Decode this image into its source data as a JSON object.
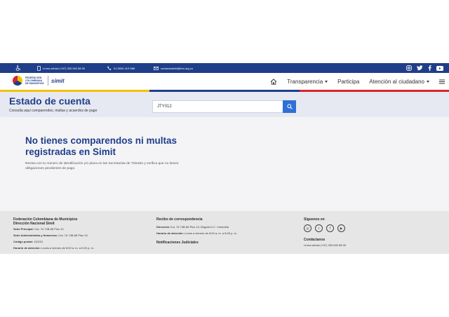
{
  "topbar": {
    "accessibility_icon": "wheelchair-icon",
    "phone_label": "Línea celular (+57) 333 602 88 00",
    "landline_label": "01 8000 413 588",
    "email_label": "contactosimit@fcm.org.co",
    "social": [
      "instagram-icon",
      "twitter-icon",
      "facebook-icon",
      "youtube-icon"
    ]
  },
  "nav": {
    "logo_org": "FEDERACIÓN COLOMBIANA DE MUNICIPIOS",
    "logo_brand": "simit",
    "links": [
      "Transparencia",
      "Participa",
      "Atención al ciudadano"
    ]
  },
  "colors": {
    "primary": "#1f3e8a",
    "yellow": "#f2c200",
    "red": "#d6262e",
    "button": "#2f6fd6"
  },
  "hero": {
    "title": "Estado de cuenta",
    "subtitle": "Consulta aquí comparendos, multas y acuerdos de pago",
    "search_value": "JTY012"
  },
  "message": {
    "title": "No tienes comparendos ni multas registradas en Simit",
    "body": "Revisa con tu número de identificación y/o placa en las Secretarías de Tránsito y verifica que no tienes obligaciones pendientes de pago."
  },
  "footer": {
    "col1": {
      "title_1": "Federación Colombiana de Municipios",
      "title_2": "Dirección Nacional Simit",
      "sede_principal_label": "Sede Principal:",
      "sede_principal": "Cra. 7# 74B-56 Piso 10",
      "sede_admin_label": "Sede Administrativa y financiera:",
      "sede_admin": "Cra. 7# 74B-56 Piso 15",
      "postal_label": "Código postal:",
      "postal": "110231",
      "horario_label": "Horario de atención:",
      "horario": "Lunes a viernes de 8:00 a. m. a 5:00 p. m."
    },
    "col2": {
      "title": "Recibo de correspondencia",
      "direccion_label": "Dirección",
      "direccion": "Cra. 7# 74B-56 Piso 10, Bogotá D.C. Colombia",
      "horario_label": "Horario de atención:",
      "horario": "Lunes a viernes de 8:00 a. m. a 5:00 p. m.",
      "notif_title": "Notificaciones Judiciales"
    },
    "col3": {
      "title": "Síguenos en",
      "contact_title": "Contáctanos",
      "phone": "Línea celular (+57) 333 602 88 00"
    }
  }
}
